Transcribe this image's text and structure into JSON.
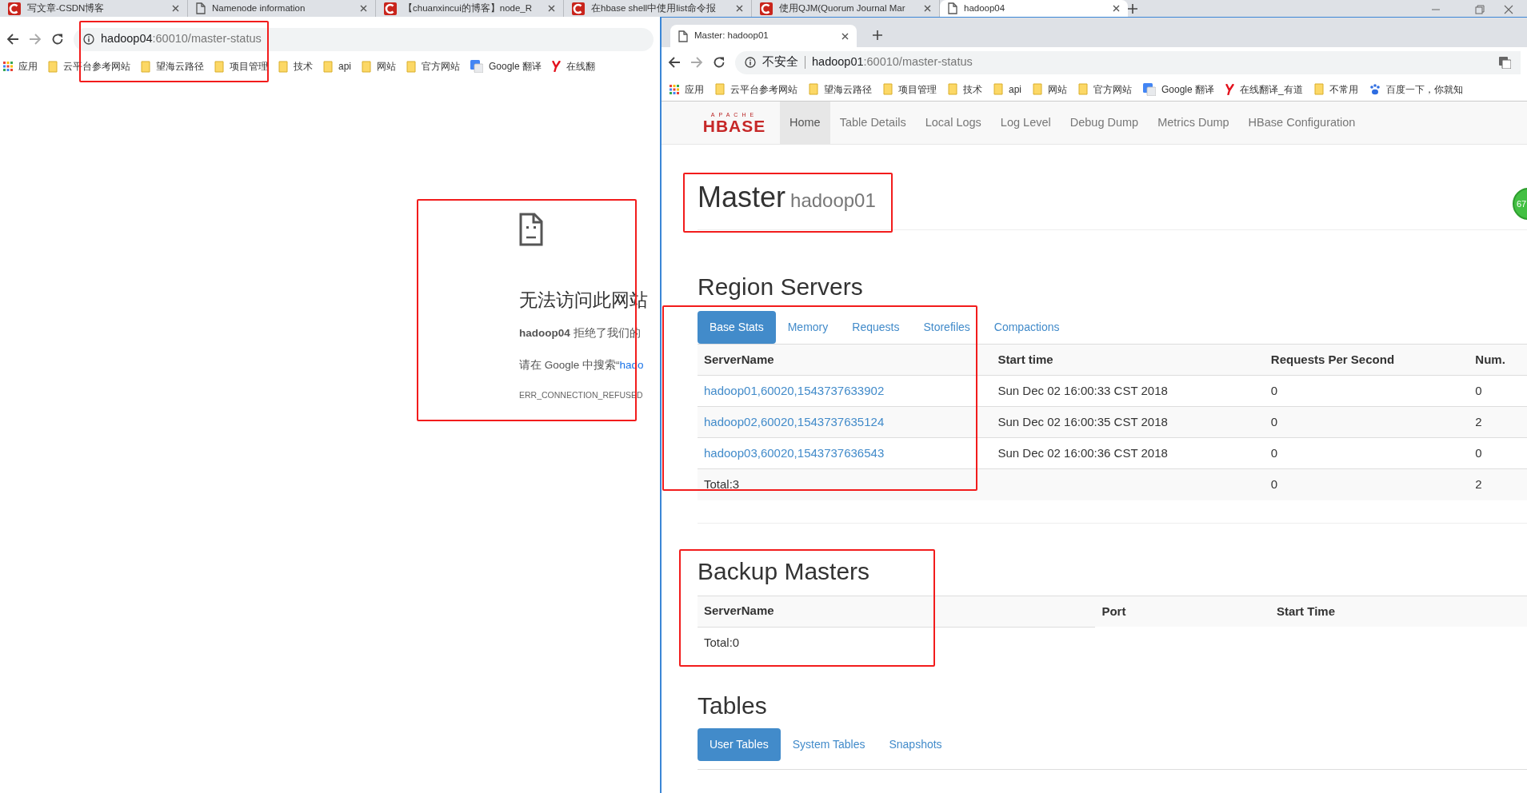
{
  "back_window": {
    "tabs": [
      {
        "title": "写文章-CSDN博客",
        "kind": "csdn",
        "selected": false
      },
      {
        "title": "Namenode information",
        "kind": "page",
        "selected": false
      },
      {
        "title": "【chuanxincui的博客】node_R",
        "kind": "csdn",
        "selected": false
      },
      {
        "title": "在hbase shell中使用list命令报",
        "kind": "csdn",
        "selected": false
      },
      {
        "title": "使用QJM(Quorum Journal Mar",
        "kind": "csdn",
        "selected": false
      },
      {
        "title": "hadoop04",
        "kind": "page",
        "selected": true
      }
    ],
    "address": {
      "host": "hadoop04",
      "path": ":60010/master-status"
    },
    "bookmarks": [
      {
        "label": "应用",
        "kind": "apps"
      },
      {
        "label": "云平台参考网站",
        "kind": "folder"
      },
      {
        "label": "望海云路径",
        "kind": "folder"
      },
      {
        "label": "项目管理",
        "kind": "folder"
      },
      {
        "label": "技术",
        "kind": "folder"
      },
      {
        "label": "api",
        "kind": "folder"
      },
      {
        "label": "网站",
        "kind": "folder"
      },
      {
        "label": "官方网站",
        "kind": "folder"
      },
      {
        "label": "Google 翻译",
        "kind": "translate"
      },
      {
        "label": "在线翻",
        "kind": "youdao"
      }
    ],
    "error_page": {
      "heading": "无法访问此网站",
      "message": "**hadoop04** 拒绝了我们的",
      "search_prefix": "请在 Google 中搜索“",
      "search_link": "hado",
      "code": "ERR_CONNECTION_REFUSED"
    }
  },
  "front_window": {
    "tabs": [
      {
        "title": "Master: hadoop01",
        "kind": "page",
        "selected": true
      }
    ],
    "address": {
      "security": "不安全",
      "host": "hadoop01",
      "path": ":60010/master-status"
    },
    "bookmarks": [
      {
        "label": "应用",
        "kind": "apps"
      },
      {
        "label": "云平台参考网站",
        "kind": "folder"
      },
      {
        "label": "望海云路径",
        "kind": "folder"
      },
      {
        "label": "项目管理",
        "kind": "folder"
      },
      {
        "label": "技术",
        "kind": "folder"
      },
      {
        "label": "api",
        "kind": "folder"
      },
      {
        "label": "网站",
        "kind": "folder"
      },
      {
        "label": "官方网站",
        "kind": "folder"
      },
      {
        "label": "Google 翻译",
        "kind": "translate"
      },
      {
        "label": "在线翻译_有道",
        "kind": "youdao"
      },
      {
        "label": "不常用",
        "kind": "folder"
      },
      {
        "label": "百度一下，你就知",
        "kind": "baidu"
      }
    ],
    "hbase_nav": {
      "logo_top": "APACHE",
      "logo": "HBASE",
      "items": [
        {
          "label": "Home",
          "selected": true
        },
        {
          "label": "Table Details",
          "selected": false
        },
        {
          "label": "Local Logs",
          "selected": false
        },
        {
          "label": "Log Level",
          "selected": false
        },
        {
          "label": "Debug Dump",
          "selected": false
        },
        {
          "label": "Metrics Dump",
          "selected": false
        },
        {
          "label": "HBase Configuration",
          "selected": false
        }
      ]
    },
    "badge": "67",
    "master": {
      "title": "Master",
      "host": "hadoop01"
    },
    "region_servers": {
      "title": "Region Servers",
      "tabs": [
        {
          "label": "Base Stats",
          "selected": true
        },
        {
          "label": "Memory",
          "selected": false
        },
        {
          "label": "Requests",
          "selected": false
        },
        {
          "label": "Storefiles",
          "selected": false
        },
        {
          "label": "Compactions",
          "selected": false
        }
      ],
      "columns": [
        "ServerName",
        "Start time",
        "Requests Per Second",
        "Num."
      ],
      "rows": [
        {
          "cells": [
            "hadoop01,60020,1543737633902",
            "Sun Dec 02 16:00:33 CST 2018",
            "0",
            "0"
          ]
        },
        {
          "cells": [
            "hadoop02,60020,1543737635124",
            "Sun Dec 02 16:00:35 CST 2018",
            "0",
            "2"
          ]
        },
        {
          "cells": [
            "hadoop03,60020,1543737636543",
            "Sun Dec 02 16:00:36 CST 2018",
            "0",
            "0"
          ]
        }
      ],
      "total": {
        "label": "Total:3",
        "requests_per_second": "0",
        "num": "2"
      }
    },
    "backup_masters": {
      "title": "Backup Masters",
      "columns": [
        "ServerName",
        "Port",
        "Start Time"
      ],
      "total": "Total:0"
    },
    "tables": {
      "title": "Tables",
      "tabs": [
        {
          "label": "User Tables",
          "selected": true
        },
        {
          "label": "System Tables",
          "selected": false
        },
        {
          "label": "Snapshots",
          "selected": false
        }
      ]
    }
  }
}
